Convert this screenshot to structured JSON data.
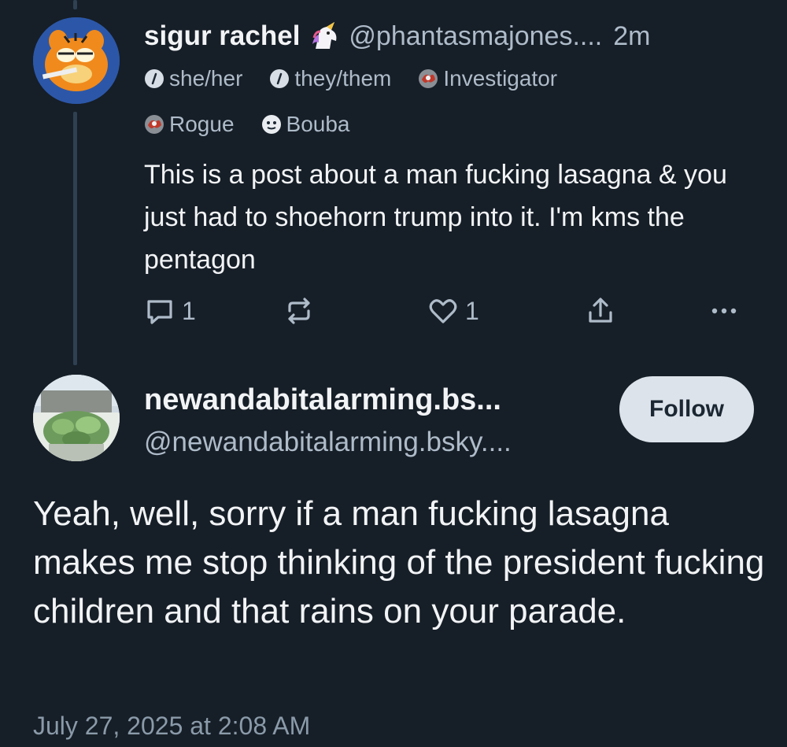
{
  "parent_post": {
    "display_name": "sigur rachel",
    "handle": "@phantasmajones....",
    "time": "2m",
    "labels_row1": [
      "she/her",
      "they/them",
      "Investigator"
    ],
    "labels_row2": [
      "Rogue",
      "Bouba"
    ],
    "text": "This is a post about a man fucking lasagna & you just had to shoehorn trump into it. I'm kms the pentagon",
    "reply_count": "1",
    "like_count": "1"
  },
  "reply_post": {
    "display_name": "newandabitalarming.bs...",
    "handle": "@newandabitalarming.bsky....",
    "follow_label": "Follow",
    "text": "Yeah, well, sorry if a man fucking lasagna makes me stop thinking of the president fucking children and that rains on your parade.",
    "timestamp": "July 27, 2025 at 2:08 AM"
  },
  "icons": {
    "label_icons": [
      "info-circle-icon",
      "info-circle-icon",
      "avatar-badge-icon",
      "avatar-badge-icon",
      "emoji-badge-icon"
    ],
    "actions": [
      "reply-icon",
      "repost-icon",
      "like-icon",
      "share-icon",
      "more-icon"
    ]
  },
  "colors": {
    "background": "#161e27",
    "text": "#f1f3f5",
    "muted": "#aebbc9",
    "thread_line": "#2e4052",
    "follow_button": "#dce3ea"
  }
}
